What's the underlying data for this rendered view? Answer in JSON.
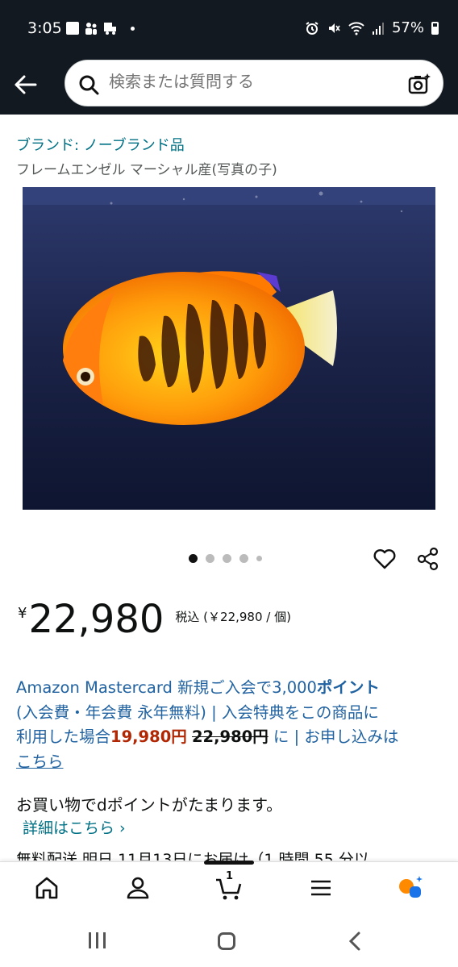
{
  "status_bar": {
    "time": "3:05",
    "battery": "57%"
  },
  "search": {
    "placeholder": "検索または質問する"
  },
  "product": {
    "brand": "ブランド: ノーブランド品",
    "title": "フレームエンゼル マーシャル産(写真の子)",
    "price_symbol": "¥",
    "price": "22,980",
    "tax_note": "税込 (￥22,980 / 個)",
    "image_count": 5
  },
  "promo": {
    "line1_a": "Amazon Mastercard 新規ご入会で3,000",
    "line1_b": "ポイント",
    "line2": "(入会費・年会費 永年無料) | 入会特典をこの商品に",
    "line3_a": "利用した場合",
    "line3_price": "19,980円",
    "line3_strike": "22,980円",
    "line3_b": "に | お申し込みは",
    "line4_link": "こちら"
  },
  "dpoint": {
    "text": "お買い物でdポイントがたまります。",
    "link": "詳細はこちら ›"
  },
  "delivery_cut": "無料配送 明日 11月13日にお届け（1 時間 55 分以",
  "bottom_nav": {
    "cart_count": "1"
  },
  "colors": {
    "header_bg": "#131921",
    "link": "#007185",
    "price_red": "#b12704"
  }
}
